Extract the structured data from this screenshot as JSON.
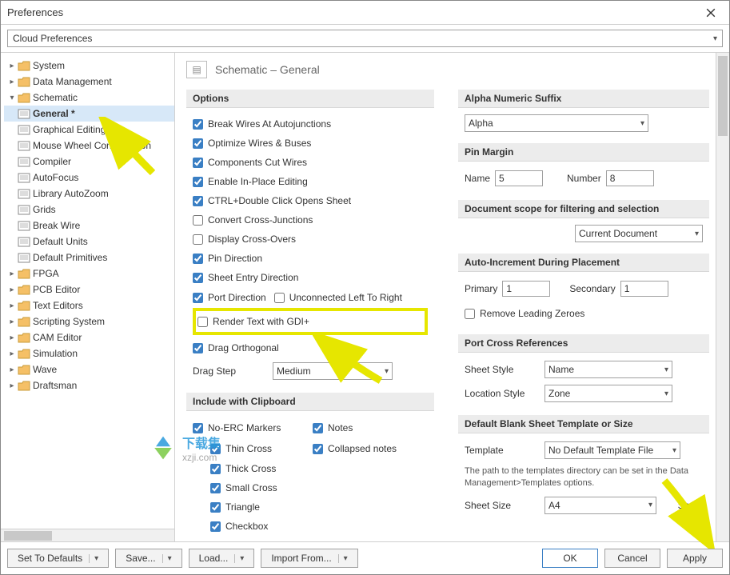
{
  "window": {
    "title": "Preferences"
  },
  "topCombo": "Cloud Preferences",
  "tree": [
    {
      "label": "System",
      "icon": "folder",
      "depth": 0,
      "tw": ">"
    },
    {
      "label": "Data Management",
      "icon": "folder",
      "depth": 0,
      "tw": ">"
    },
    {
      "label": "Schematic",
      "icon": "folder",
      "depth": 0,
      "tw": "v"
    },
    {
      "label": "General *",
      "icon": "page",
      "depth": 1,
      "tw": "",
      "selected": true,
      "bold": true
    },
    {
      "label": "Graphical Editing",
      "icon": "page",
      "depth": 1,
      "tw": ""
    },
    {
      "label": "Mouse Wheel Configuration",
      "icon": "page",
      "depth": 1,
      "tw": ""
    },
    {
      "label": "Compiler",
      "icon": "page",
      "depth": 1,
      "tw": ""
    },
    {
      "label": "AutoFocus",
      "icon": "page",
      "depth": 1,
      "tw": ""
    },
    {
      "label": "Library AutoZoom",
      "icon": "page",
      "depth": 1,
      "tw": ""
    },
    {
      "label": "Grids",
      "icon": "page",
      "depth": 1,
      "tw": ""
    },
    {
      "label": "Break Wire",
      "icon": "page",
      "depth": 1,
      "tw": ""
    },
    {
      "label": "Default Units",
      "icon": "page",
      "depth": 1,
      "tw": ""
    },
    {
      "label": "Default Primitives",
      "icon": "page",
      "depth": 1,
      "tw": ""
    },
    {
      "label": "FPGA",
      "icon": "folder",
      "depth": 0,
      "tw": ">"
    },
    {
      "label": "PCB Editor",
      "icon": "folder",
      "depth": 0,
      "tw": ">"
    },
    {
      "label": "Text Editors",
      "icon": "folder",
      "depth": 0,
      "tw": ">"
    },
    {
      "label": "Scripting System",
      "icon": "folder",
      "depth": 0,
      "tw": ">"
    },
    {
      "label": "CAM Editor",
      "icon": "folder",
      "depth": 0,
      "tw": ">"
    },
    {
      "label": "Simulation",
      "icon": "folder",
      "depth": 0,
      "tw": ">"
    },
    {
      "label": "Wave",
      "icon": "folder",
      "depth": 0,
      "tw": ">"
    },
    {
      "label": "Draftsman",
      "icon": "folder",
      "depth": 0,
      "tw": ">"
    }
  ],
  "page": {
    "title": "Schematic – General"
  },
  "options": {
    "title": "Options",
    "items": [
      {
        "label": "Break Wires At Autojunctions",
        "checked": true
      },
      {
        "label": "Optimize Wires & Buses",
        "checked": true
      },
      {
        "label": "Components Cut Wires",
        "checked": true
      },
      {
        "label": "Enable In-Place Editing",
        "checked": true
      },
      {
        "label": "CTRL+Double Click Opens Sheet",
        "checked": true
      },
      {
        "label": "Convert Cross-Junctions",
        "checked": false
      },
      {
        "label": "Display Cross-Overs",
        "checked": false
      },
      {
        "label": "Pin Direction",
        "checked": true
      },
      {
        "label": "Sheet Entry Direction",
        "checked": true
      }
    ],
    "portDirection": {
      "label": "Port Direction",
      "checked": true
    },
    "unconnectedLR": {
      "label": "Unconnected Left To Right",
      "checked": false
    },
    "renderGDI": {
      "label": "Render Text with GDI+",
      "checked": false
    },
    "dragOrtho": {
      "label": "Drag Orthogonal",
      "checked": true
    },
    "dragStepLabel": "Drag Step",
    "dragStepValue": "Medium"
  },
  "clipboard": {
    "title": "Include with Clipboard",
    "noerc": {
      "label": "No-ERC Markers",
      "checked": true
    },
    "notes": {
      "label": "Notes",
      "checked": true
    },
    "thin": {
      "label": "Thin Cross",
      "checked": true
    },
    "collapsed": {
      "label": "Collapsed notes",
      "checked": true
    },
    "thick": {
      "label": "Thick Cross",
      "checked": true
    },
    "small": {
      "label": "Small Cross",
      "checked": true
    },
    "triangle": {
      "label": "Triangle",
      "checked": true
    },
    "checkbox": {
      "label": "Checkbox",
      "checked": true
    }
  },
  "suffix": {
    "title": "Alpha Numeric Suffix",
    "value": "Alpha"
  },
  "pinMargin": {
    "title": "Pin Margin",
    "nameLabel": "Name",
    "nameValue": "5",
    "numberLabel": "Number",
    "numberValue": "8"
  },
  "docScope": {
    "title": "Document scope for filtering and selection",
    "value": "Current Document"
  },
  "autoInc": {
    "title": "Auto-Increment During Placement",
    "primaryLabel": "Primary",
    "primaryValue": "1",
    "secondaryLabel": "Secondary",
    "secondaryValue": "1",
    "removeZeroes": {
      "label": "Remove Leading Zeroes",
      "checked": false
    }
  },
  "portCross": {
    "title": "Port Cross References",
    "sheetLabel": "Sheet Style",
    "sheetValue": "Name",
    "locLabel": "Location Style",
    "locValue": "Zone"
  },
  "template": {
    "title": "Default Blank Sheet Template or Size",
    "tplLabel": "Template",
    "tplValue": "No Default Template File",
    "hint": "The path to the templates directory can be set in the Data Management>Templates options.",
    "sizeLabel": "Sheet Size",
    "sizeValue": "A4",
    "sheetDimPartial": "Sheet"
  },
  "bottom": {
    "setDefaults": "Set To Defaults",
    "save": "Save...",
    "load": "Load...",
    "import": "Import From...",
    "ok": "OK",
    "cancel": "Cancel",
    "apply": "Apply"
  },
  "watermark": {
    "line1": "下载集",
    "line2": "xzji.com"
  }
}
